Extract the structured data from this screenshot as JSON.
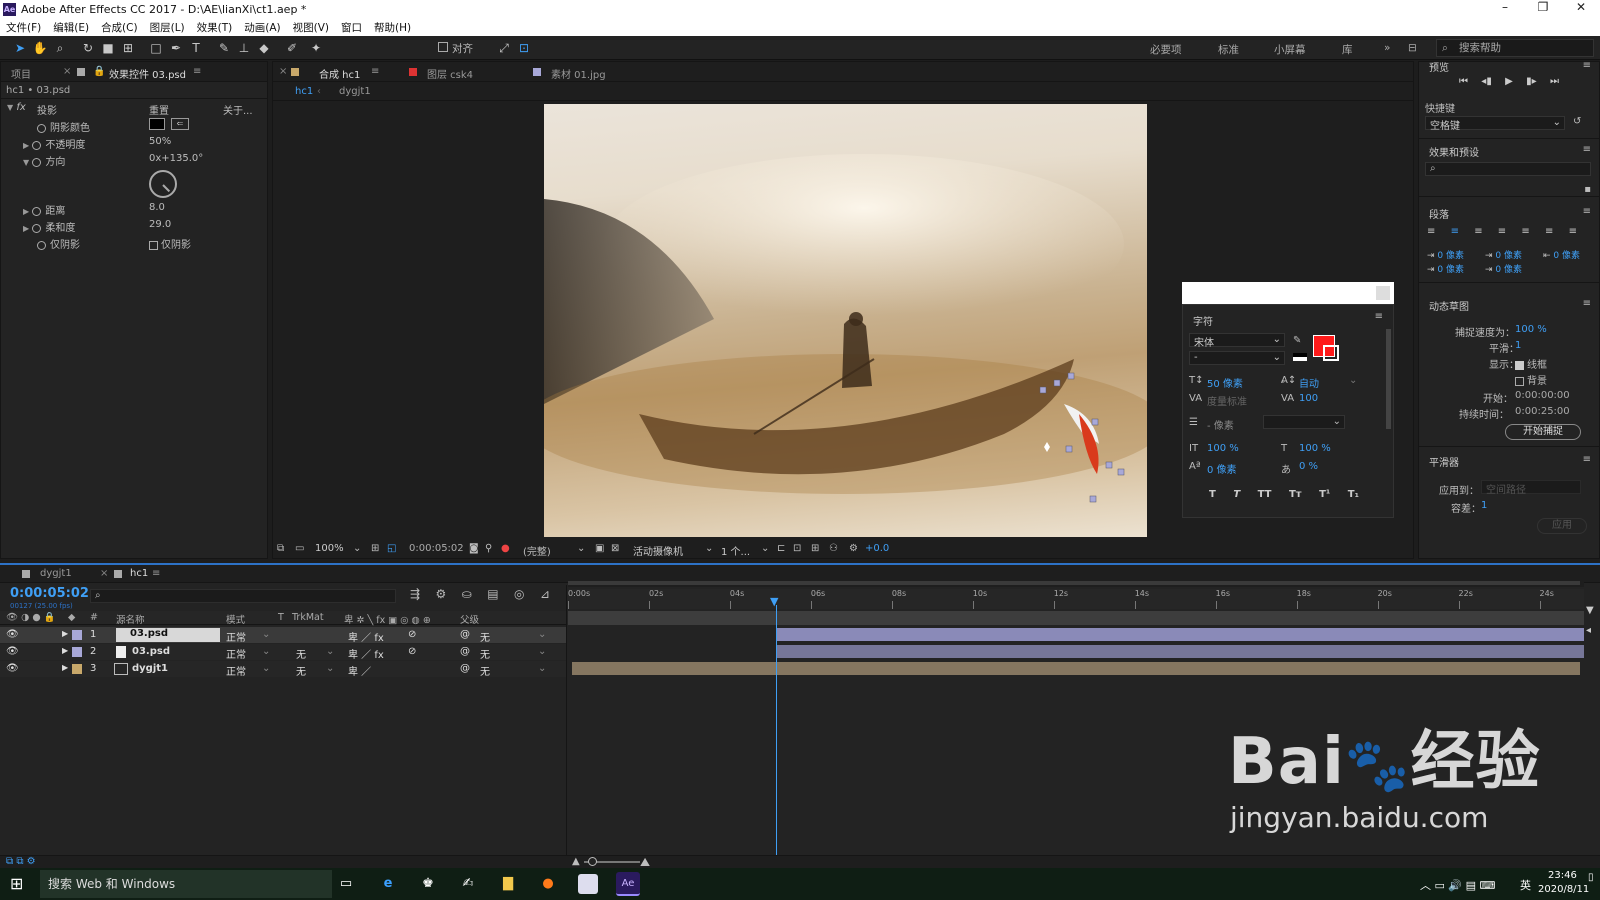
{
  "titlebar": {
    "title": "Adobe After Effects CC 2017 - D:\\AE\\lianXi\\ct1.aep *"
  },
  "menu": [
    "文件(F)",
    "编辑(E)",
    "合成(C)",
    "图层(L)",
    "效果(T)",
    "动画(A)",
    "视图(V)",
    "窗口",
    "帮助(H)"
  ],
  "toolbar": {
    "snap_label": "对齐",
    "workspaces": [
      "必要项",
      "标准",
      "小屏幕",
      "库"
    ],
    "search_label": "搜索帮助"
  },
  "effects_panel": {
    "tab_project": "项目",
    "tab_effects": "效果控件 03.psd",
    "breadcrumb": "hc1 • 03.psd",
    "effect_name": "投影",
    "reset": "重置",
    "about": "关于...",
    "props": [
      {
        "name": "阴影颜色",
        "value": ""
      },
      {
        "name": "不透明度",
        "value": "50%"
      },
      {
        "name": "方向",
        "value": "0x+135.0°"
      },
      {
        "name": "距离",
        "value": "8.0"
      },
      {
        "name": "柔和度",
        "value": "29.0"
      },
      {
        "name": "仅阴影",
        "value": "仅阴影"
      }
    ]
  },
  "comp_panel": {
    "tab_comp": "合成 hc1",
    "tab_layer": "图层 csk4",
    "tab_footage": "素材 01.jpg",
    "breadcrumbs": [
      "hc1",
      "dygjt1"
    ],
    "footer": {
      "zoom": "100%",
      "time": "0:00:05:02",
      "quality": "(完整)",
      "camera": "活动摄像机",
      "views": "1 个...",
      "exposure": "+0.0"
    }
  },
  "char_panel": {
    "title": "字符",
    "font": "宋体",
    "style": "-",
    "size": "50 像素",
    "leading": "自动",
    "kerning": "度量标准",
    "tracking": "100",
    "stroke": "- 像素",
    "vscale": "100 %",
    "hscale": "100 %",
    "baseline": "0 像素",
    "tsume": "0 %",
    "styles": [
      "T",
      "T",
      "TT",
      "Tт",
      "T¹",
      "T₁"
    ],
    "fill_color": "#ff1a1a"
  },
  "right_panel": {
    "preview": "预览",
    "shortcut_label": "快捷键",
    "shortcut_value": "空格键",
    "effects_presets": "效果和预设",
    "paragraph": "段落",
    "para_values": [
      "0 像素",
      "0 像素",
      "0 像素",
      "0 像素",
      "0 像素"
    ],
    "motion_sketch": "动态草图",
    "capture_speed_label": "捕捉速度为：",
    "capture_speed": "100 %",
    "smooth_label": "平滑：",
    "smooth": "1",
    "show_label": "显示：",
    "wire": "线框",
    "bg": "背景",
    "start_label": "开始：",
    "start": "0:00:00:00",
    "duration_label": "持续时间：",
    "duration": "0:00:25:00",
    "capture_btn": "开始捕捉",
    "smoother": "平滑器",
    "apply_to_label": "应用到：",
    "apply_to": "空间路径",
    "tolerance_label": "容差：",
    "tolerance": "1",
    "apply_btn": "应用"
  },
  "timeline": {
    "tab1": "dygjt1",
    "tab2": "hc1",
    "timecode": "0:00:05:02",
    "fps": "00127 (25.00 fps)",
    "headers": {
      "num": "#",
      "name": "源名称",
      "mode": "模式",
      "t": "T",
      "trkmat": "TrkMat",
      "parent": "父级"
    },
    "ruler": [
      "0:00s",
      "02s",
      "04s",
      "06s",
      "08s",
      "10s",
      "12s",
      "14s",
      "16s",
      "18s",
      "20s",
      "22s",
      "24s"
    ],
    "layers": [
      {
        "num": "1",
        "name": "03.psd",
        "mode": "正常",
        "trkmat": "",
        "parent": "无"
      },
      {
        "num": "2",
        "name": "03.psd",
        "mode": "正常",
        "trkmat": "无",
        "parent": "无"
      },
      {
        "num": "3",
        "name": "dygjt1",
        "mode": "正常",
        "trkmat": "无",
        "parent": "无"
      }
    ]
  },
  "taskbar": {
    "search": "搜索 Web 和 Windows",
    "time": "23:46",
    "date": "2020/8/11",
    "lang": "英"
  },
  "watermark": {
    "brand": "Bai",
    "brand2": "经验",
    "url": "jingyan.baidu.com"
  }
}
